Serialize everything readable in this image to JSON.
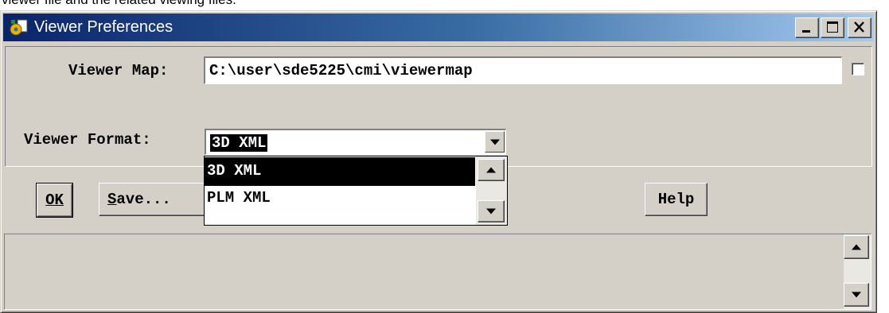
{
  "doc_fragment": "viewer file and the related viewing files.",
  "window": {
    "title": "Viewer Preferences",
    "icon": "app-gear-document-icon",
    "caption_buttons": [
      "minimize-icon",
      "maximize-icon",
      "close-icon"
    ]
  },
  "form": {
    "viewer_map_label": "Viewer Map:",
    "viewer_map_value": "C:\\user\\sde5225\\cmi\\viewermap",
    "viewer_map_checkbox_checked": false,
    "viewer_format_label": "Viewer Format:",
    "viewer_format_value": "3D XML",
    "viewer_format_options": [
      "3D XML",
      "PLM XML"
    ]
  },
  "buttons": {
    "ok_label": "OK",
    "save_label": "Save...",
    "help_label": "Help"
  },
  "colors": {
    "face": "#d4d0c8",
    "title_start": "#0a246a",
    "title_end": "#a6caf0",
    "selection": "#000000"
  }
}
